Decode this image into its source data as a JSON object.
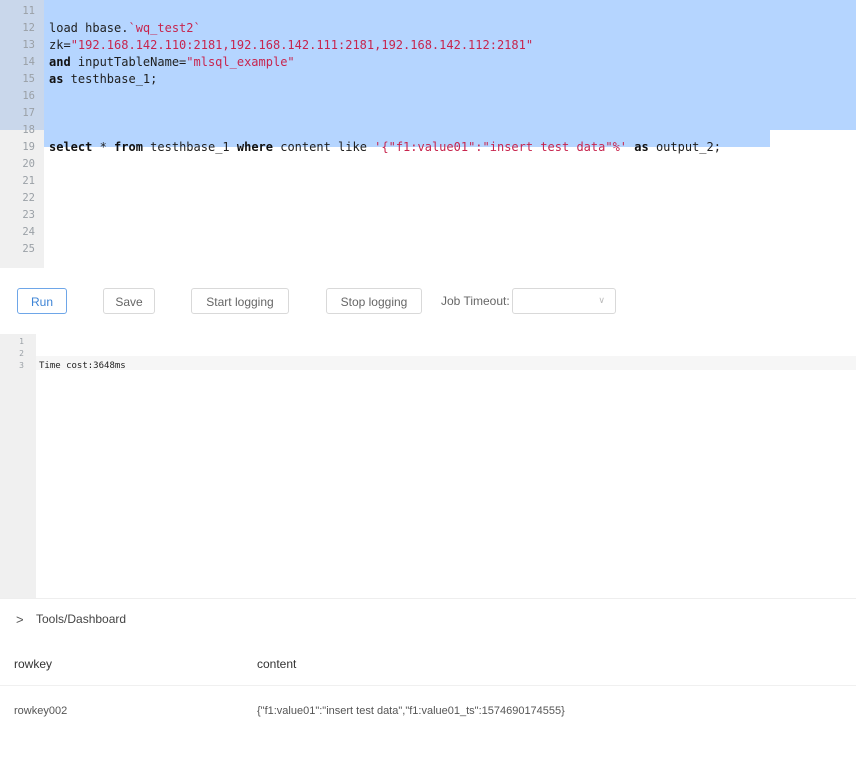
{
  "editor": {
    "lines": [
      {
        "num": "11",
        "segments": []
      },
      {
        "num": "12",
        "segments": [
          {
            "t": "load hbase.",
            "c": "plain"
          },
          {
            "t": "`wq_test2`",
            "c": "str"
          }
        ]
      },
      {
        "num": "13",
        "segments": [
          {
            "t": "zk=",
            "c": "plain"
          },
          {
            "t": "\"192.168.142.110:2181,192.168.142.111:2181,192.168.142.112:2181\"",
            "c": "str"
          }
        ]
      },
      {
        "num": "14",
        "segments": [
          {
            "t": "and",
            "c": "kw"
          },
          {
            "t": " inputTableName=",
            "c": "plain"
          },
          {
            "t": "\"mlsql_example\"",
            "c": "str"
          }
        ]
      },
      {
        "num": "15",
        "segments": [
          {
            "t": "as",
            "c": "kw"
          },
          {
            "t": " testhbase_1;",
            "c": "plain"
          }
        ]
      },
      {
        "num": "16",
        "segments": []
      },
      {
        "num": "17",
        "segments": []
      },
      {
        "num": "18",
        "segments": []
      },
      {
        "num": "19",
        "segments": [
          {
            "t": "select",
            "c": "kw"
          },
          {
            "t": " * ",
            "c": "plain"
          },
          {
            "t": "from",
            "c": "kw"
          },
          {
            "t": " testhbase_1 ",
            "c": "plain"
          },
          {
            "t": "where",
            "c": "kw"
          },
          {
            "t": " content like ",
            "c": "plain"
          },
          {
            "t": "'{\"f1:value01\":\"insert test data\"%'",
            "c": "str"
          },
          {
            "t": " ",
            "c": "plain"
          },
          {
            "t": "as",
            "c": "kw"
          },
          {
            "t": " output_2;",
            "c": "plain"
          }
        ]
      },
      {
        "num": "20",
        "segments": []
      },
      {
        "num": "21",
        "segments": []
      },
      {
        "num": "22",
        "segments": []
      },
      {
        "num": "23",
        "segments": []
      },
      {
        "num": "24",
        "segments": []
      },
      {
        "num": "25",
        "segments": []
      }
    ]
  },
  "toolbar": {
    "run_label": "Run",
    "save_label": "Save",
    "start_logging_label": "Start logging",
    "stop_logging_label": "Stop logging",
    "job_timeout_label": "Job Timeout:",
    "job_timeout_value": ""
  },
  "log": {
    "lines": [
      {
        "num": "1",
        "text": ""
      },
      {
        "num": "2",
        "text": ""
      },
      {
        "num": "3",
        "text": "Time cost:3648ms"
      }
    ]
  },
  "tools": {
    "label": "Tools/Dashboard"
  },
  "table": {
    "columns": [
      "rowkey",
      "content"
    ],
    "rows": [
      [
        "rowkey002",
        "{\"f1:value01\":\"insert test data\",\"f1:value01_ts\":1574690174555}"
      ]
    ]
  },
  "colors": {
    "selection": "#b5d5ff",
    "keyword": "#111111",
    "string": "#c7254e",
    "primary": "#3d84d6"
  }
}
